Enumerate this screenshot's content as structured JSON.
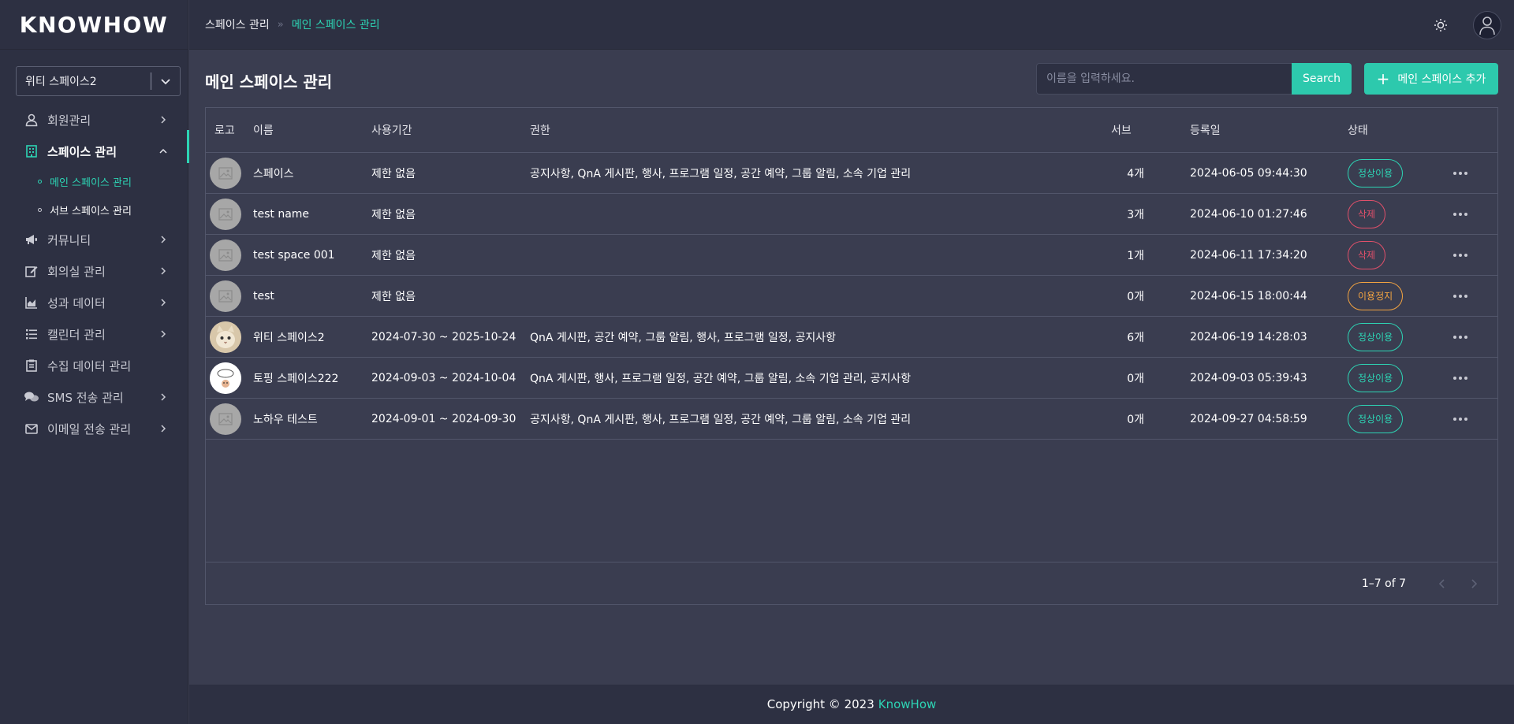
{
  "app": {
    "logo": "KNOWHOW",
    "accent": "#2dd4b4"
  },
  "space_select": {
    "value": "위티 스페이스2"
  },
  "sidebar": {
    "items": [
      {
        "label": "회원관리",
        "icon": "user-icon"
      },
      {
        "label": "스페이스 관리",
        "icon": "building-icon",
        "active": true,
        "children": [
          {
            "label": "메인 스페이스 관리",
            "active": true
          },
          {
            "label": "서브 스페이스 관리"
          }
        ]
      },
      {
        "label": "커뮤니티",
        "icon": "megaphone-icon"
      },
      {
        "label": "회의실 관리",
        "icon": "edit-icon"
      },
      {
        "label": "성과 데이터",
        "icon": "area-chart-icon"
      },
      {
        "label": "캘린더 관리",
        "icon": "list-icon"
      },
      {
        "label": "수집 데이터 관리",
        "icon": "clipboard-icon"
      },
      {
        "label": "SMS 전송 관리",
        "icon": "chat-icon"
      },
      {
        "label": "이메일 전송 관리",
        "icon": "mail-icon"
      }
    ]
  },
  "breadcrumb": {
    "parent": "스페이스 관리",
    "separator": "»",
    "current": "메인 스페이스 관리"
  },
  "page": {
    "title": "메인 스페이스 관리",
    "search_placeholder": "이름을 입력하세요.",
    "search_label": "Search",
    "add_label": "메인 스페이스 추가"
  },
  "table": {
    "headers": {
      "logo": "로고",
      "name": "이름",
      "period": "사용기간",
      "perm": "권한",
      "sub": "서브",
      "date": "등록일",
      "status": "상태"
    },
    "rows": [
      {
        "name": "스페이스",
        "period": "제한 없음",
        "perm": "공지사항, QnA 게시판, 행사, 프로그램 일정, 공간 예약, 그룹 알림, 소속 기업 관리",
        "sub": "4개",
        "date": "2024-06-05 09:44:30",
        "status": "정상이용",
        "status_type": "normal",
        "logo": "placeholder"
      },
      {
        "name": "test name",
        "period": "제한 없음",
        "perm": "",
        "sub": "3개",
        "date": "2024-06-10 01:27:46",
        "status": "삭제",
        "status_type": "deleted",
        "logo": "placeholder"
      },
      {
        "name": "test space 001",
        "period": "제한 없음",
        "perm": "",
        "sub": "1개",
        "date": "2024-06-11 17:34:20",
        "status": "삭제",
        "status_type": "deleted",
        "logo": "placeholder"
      },
      {
        "name": "test",
        "period": "제한 없음",
        "perm": "",
        "sub": "0개",
        "date": "2024-06-15 18:00:44",
        "status": "이용정지",
        "status_type": "paused",
        "logo": "placeholder"
      },
      {
        "name": "위티 스페이스2",
        "period": "2024-07-30 ~ 2025-10-24",
        "perm": "QnA 게시판, 공간 예약, 그룹 알림, 행사, 프로그램 일정, 공지사항",
        "sub": "6개",
        "date": "2024-06-19 14:28:03",
        "status": "정상이용",
        "status_type": "normal",
        "logo": "cat"
      },
      {
        "name": "토핑 스페이스222",
        "period": "2024-09-03 ~ 2024-10-04",
        "perm": "QnA 게시판, 행사, 프로그램 일정, 공간 예약, 그룹 알림, 소속 기업 관리, 공지사항",
        "sub": "0개",
        "date": "2024-09-03 05:39:43",
        "status": "정상이용",
        "status_type": "normal",
        "logo": "white"
      },
      {
        "name": "노하우 테스트",
        "period": "2024-09-01 ~ 2024-09-30",
        "perm": "공지사항, QnA 게시판, 행사, 프로그램 일정, 공간 예약, 그룹 알림, 소속 기업 관리",
        "sub": "0개",
        "date": "2024-09-27 04:58:59",
        "status": "정상이용",
        "status_type": "normal",
        "logo": "placeholder"
      }
    ]
  },
  "pagination": {
    "text": "1–7 of 7"
  },
  "footer": {
    "text": "Copyright © 2023",
    "brand": "KnowHow"
  }
}
